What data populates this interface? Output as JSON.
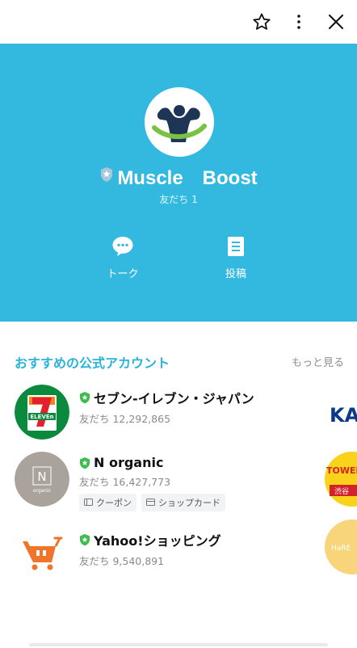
{
  "topbar": {
    "icons": [
      "star-icon",
      "more-vertical-icon",
      "close-icon"
    ]
  },
  "profile": {
    "name": "Muscle　Boost",
    "friends": "友だち 1",
    "bg_color": "#33b9e0",
    "actions": [
      {
        "label": "トーク",
        "icon": "chat-bubble-icon"
      },
      {
        "label": "投稿",
        "icon": "post-document-icon"
      }
    ]
  },
  "recommended": {
    "title": "おすすめの公式アカウント",
    "more_label": "もっと見る",
    "accounts": [
      {
        "name": "セブン-イレブン・ジャパン",
        "friends": "友だち 12,292,865",
        "chips": []
      },
      {
        "name": "N organic",
        "friends": "友だち 16,427,773",
        "chips": [
          "クーポン",
          "ショップカード"
        ]
      },
      {
        "name": "Yahoo!ショッピング",
        "friends": "友だち 9,540,891",
        "chips": []
      }
    ],
    "peek_labels": [
      "KA",
      "TOWER RECORDS",
      "渋谷",
      "HaRE"
    ]
  }
}
